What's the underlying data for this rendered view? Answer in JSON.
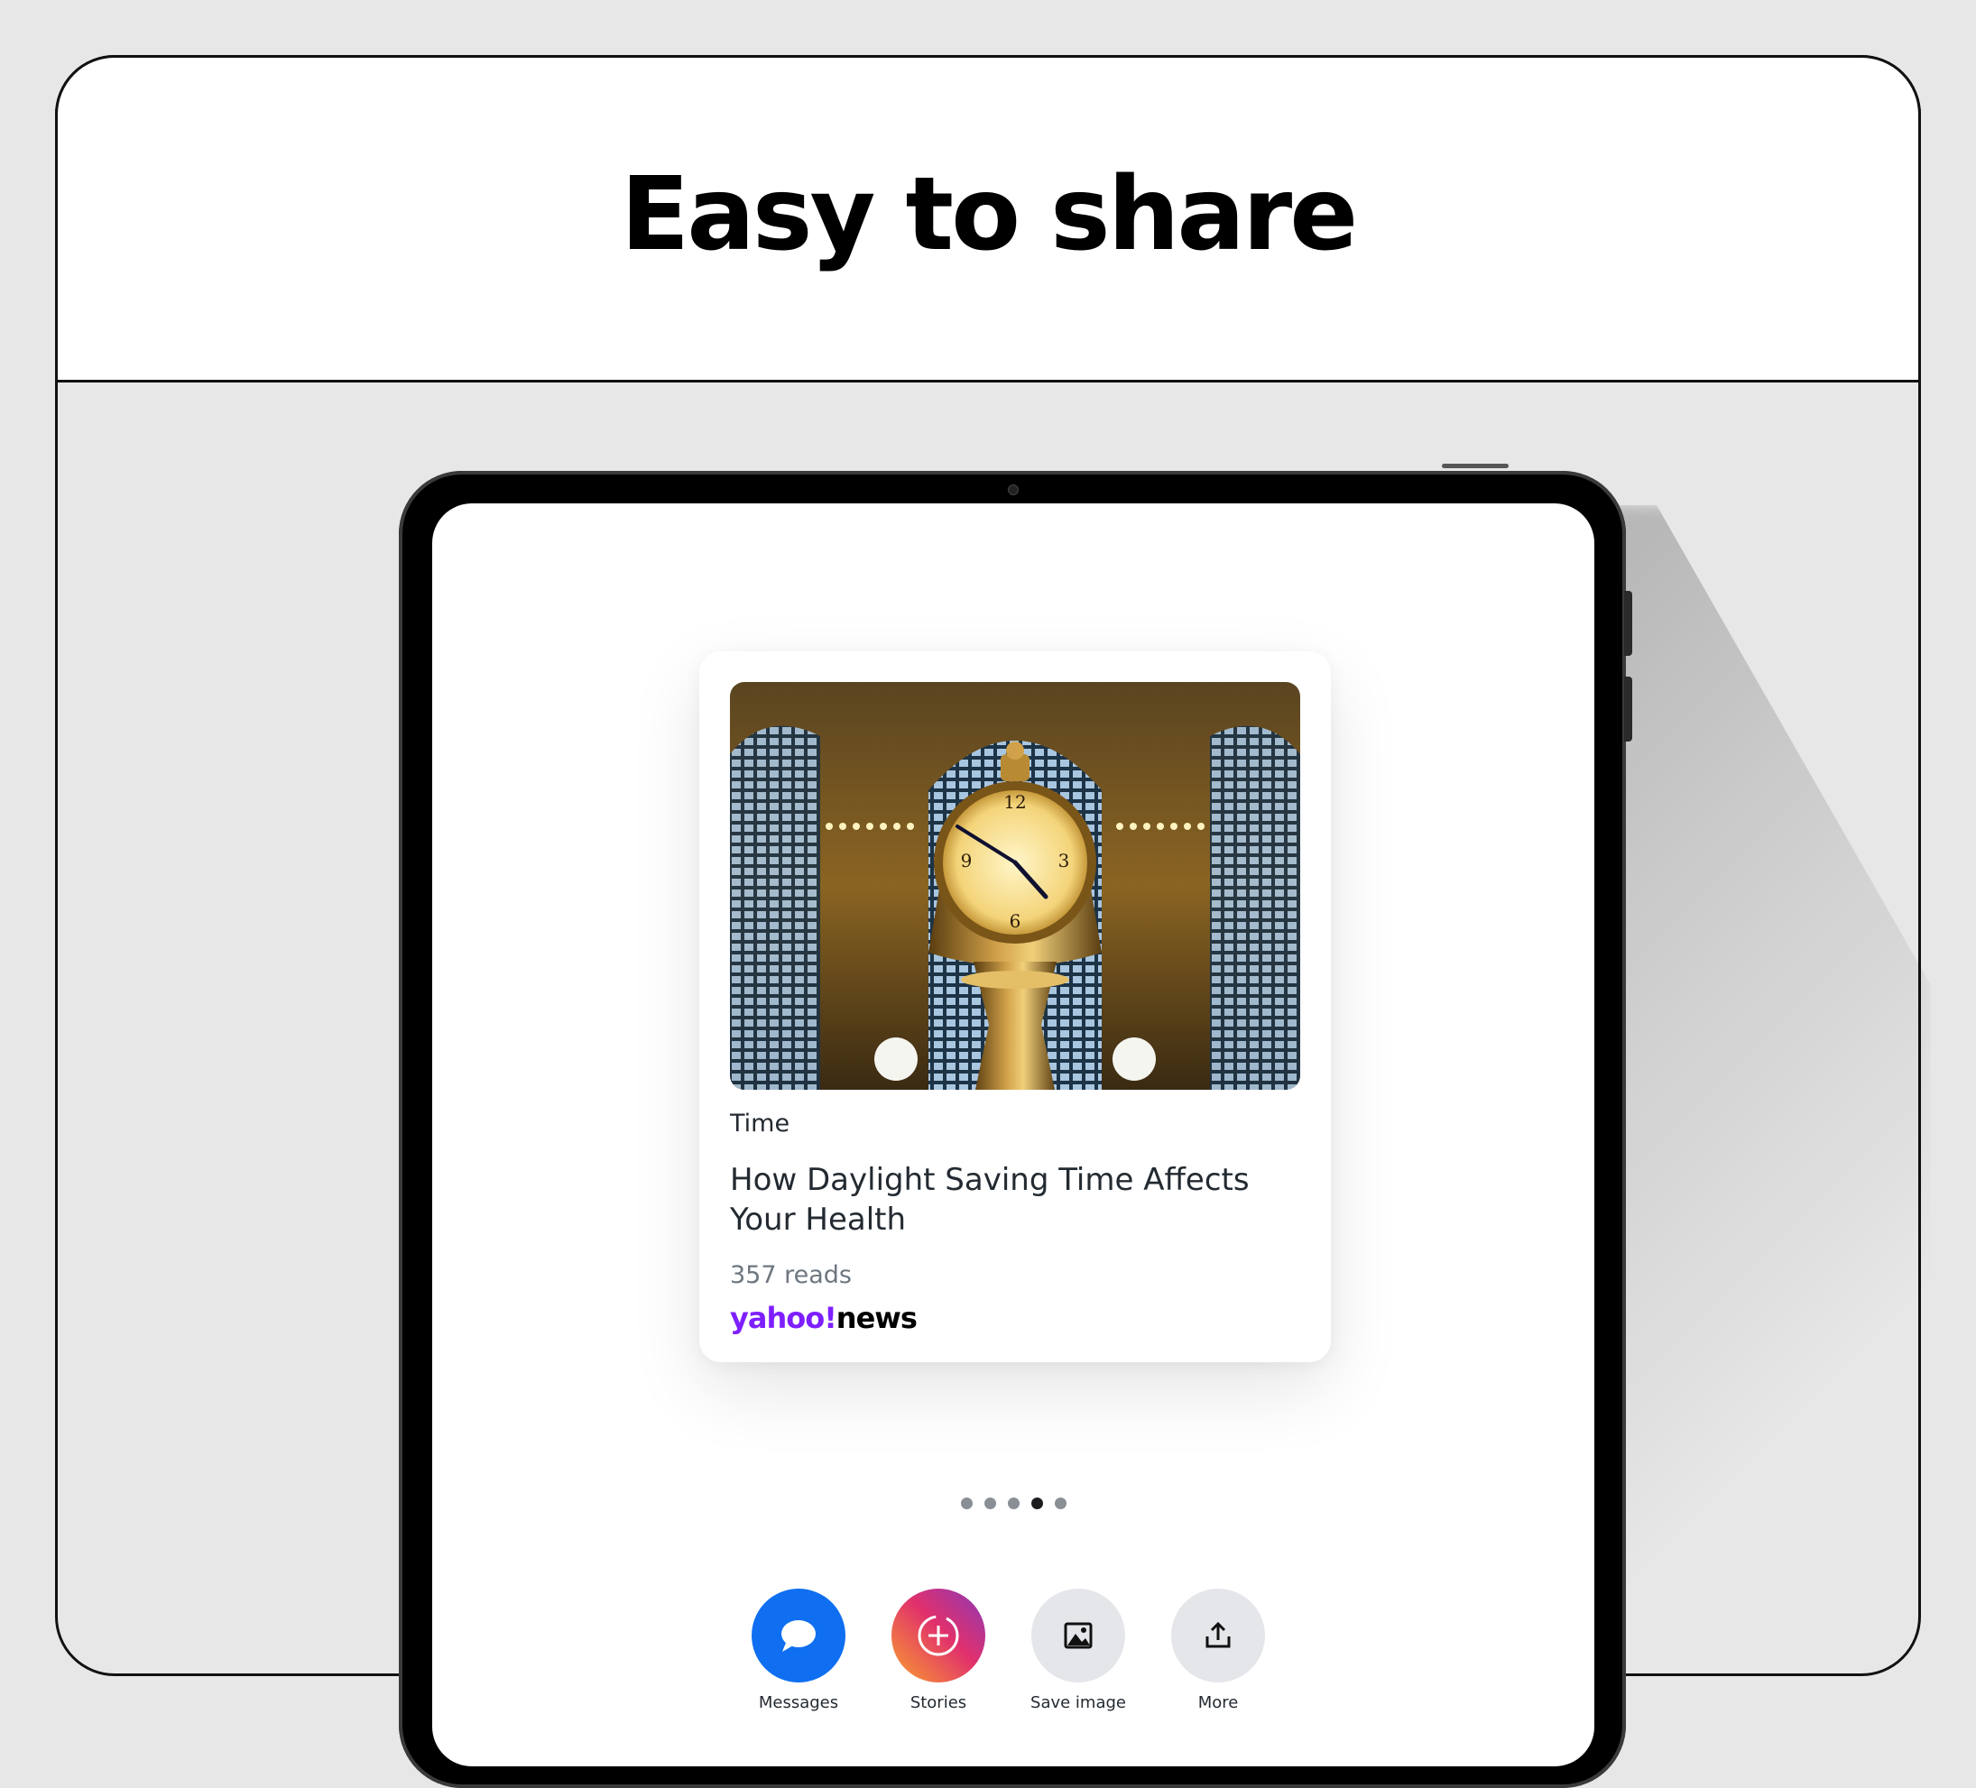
{
  "header": {
    "title": "Easy to share"
  },
  "card": {
    "category": "Time",
    "headline": "How Daylight Saving Time Affects Your Health",
    "reads": "357 reads",
    "brand": {
      "part1": "yahoo",
      "bang": "!",
      "part2": "news"
    }
  },
  "pager": {
    "count": 5,
    "active_index": 3
  },
  "share": {
    "items": [
      {
        "label": "Messages",
        "icon": "message-bubble-icon",
        "color": "#0f6ff0"
      },
      {
        "label": "Stories",
        "icon": "story-add-icon",
        "color": "#e1306c"
      },
      {
        "label": "Save image",
        "icon": "image-icon",
        "color": "#e4e6ea"
      },
      {
        "label": "More",
        "icon": "share-up-icon",
        "color": "#e4e6ea"
      }
    ]
  },
  "colors": {
    "brand_purple": "#7e1fff",
    "background": "#e7e7e7"
  }
}
